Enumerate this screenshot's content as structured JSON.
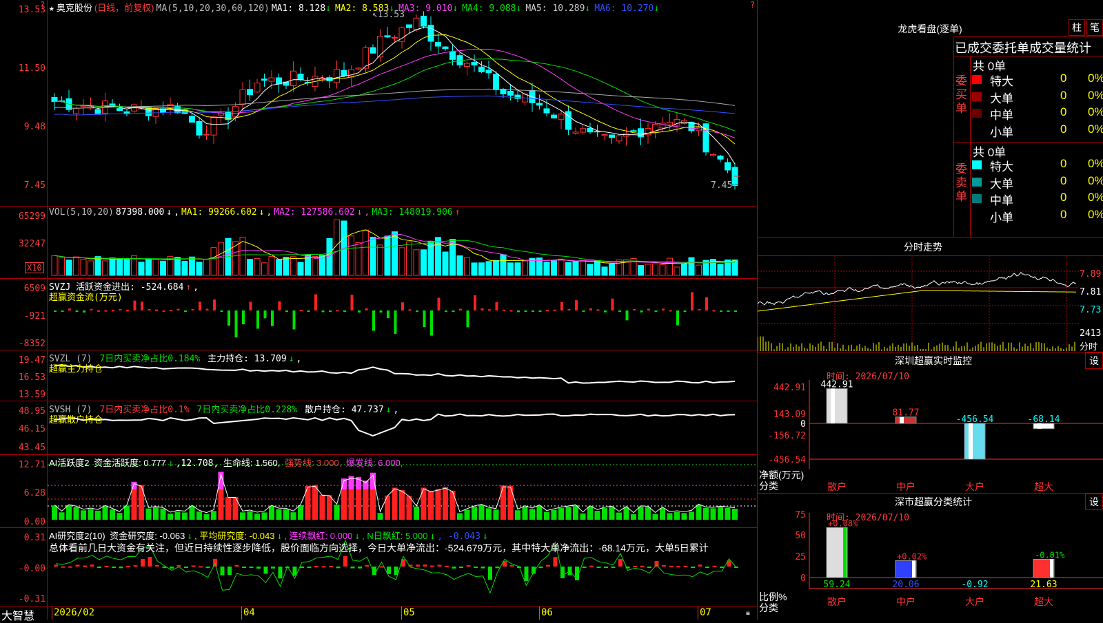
{
  "stock": {
    "name": "奥克股份",
    "mode": "(日线，前复权)"
  },
  "main": {
    "indicator": "MA(5,10,20,30,60,120)",
    "ma": [
      {
        "label": "MA1:",
        "value": "8.128",
        "dir": "↓",
        "color": "#ffffff"
      },
      {
        "label": "MA2:",
        "value": "8.583",
        "dir": "↓",
        "color": "#ffff00"
      },
      {
        "label": "MA3:",
        "value": "9.010",
        "dir": "↓",
        "color": "#ff3bff"
      },
      {
        "label": "MA4:",
        "value": "9.088",
        "dir": "↓",
        "color": "#00e000"
      },
      {
        "label": "MA5:",
        "value": "10.289",
        "dir": "↓",
        "color": "#cccccc"
      },
      {
        "label": "MA6:",
        "value": "10.270",
        "dir": "↓",
        "color": "#3050ff"
      }
    ],
    "y_labels": [
      "13.53",
      "11.50",
      "9.48",
      "7.45"
    ],
    "high_mark": "13.53",
    "low_mark": "7.45"
  },
  "vol": {
    "indicator": "VOL(5,10,20)",
    "value": "87398.000",
    "value_dir": "↓",
    "ma1": "MA1: 99266.602",
    "ma1_dir": "↓",
    "ma2": "MA2: 127586.602",
    "ma2_dir": "↓",
    "ma3": "MA3: 148019.906",
    "ma3_dir": "↑",
    "y_labels": [
      "65299",
      "32247"
    ],
    "unit": "X10"
  },
  "svzj": {
    "line1": "SVZJ  活跃资金进出: -524.684",
    "line1_dir": "↑",
    "line1_tail": ",",
    "line2": "超赢资金流(万元)",
    "y_labels": [
      "6509",
      "-921",
      "-8352"
    ]
  },
  "svzl": {
    "prefix": "SVZL (7) ",
    "green": "7日内买卖净占比0.184%",
    "white": " 主力持仓: 13.709",
    "dir": "↓",
    "tail": ",",
    "line2": "超赢主力持仓",
    "y_labels": [
      "19.47",
      "16.53",
      "13.59"
    ]
  },
  "svsh": {
    "prefix": "SVSH (7) ",
    "red": "7日内买卖净占比0.1%",
    "green": " 7日内买卖净占比0.228%",
    "white": " 散户持仓: 47.737",
    "dir": "↓",
    "tail": ",",
    "line2": "超赢散户持仓",
    "y_labels": [
      "48.95",
      "46.15",
      "43.45"
    ]
  },
  "ai1": {
    "title": "AI活跃度2",
    "t1": " 资金活跃度: 0.777",
    "t2": ",12.708,",
    "t3": " 生命线: 1.560,",
    "t4": " 强势线: 3.000,",
    "t5": " 爆发线: 6.000,",
    "y_labels": [
      "12.71",
      "6.28",
      "0.00"
    ]
  },
  "ai2": {
    "title": "AI研究度2(10)",
    "t1": " 资金研究度: -0.063",
    "t2": ", 平均研究度: -0.043",
    "t3": ", 连续飘红: 0.000",
    "t4": ", N日飘红: 5.000",
    "t5": ", -0.043",
    "summary": "总体看前几日大资金有关注，但近日持续性逐步降低，股价面临方向选择，今日大单净流出：-524.679万元，其中特大单净流出：-68.14万元，大单5日累计",
    "y_labels": [
      "0.31",
      "-0.00",
      "-0.31"
    ]
  },
  "dates": {
    "d1": "2026/02",
    "d2": "04",
    "d3": "05",
    "d4": "06",
    "d5": "07"
  },
  "bottom_tab": "大智慧",
  "right": {
    "lhkp": {
      "title": "龙虎看盘(逐单)",
      "btn1": "柱",
      "btn2": "笔",
      "subtitle": "已成交委托单成交量统计"
    },
    "buy": {
      "label": "委买单",
      "total": "共 0单",
      "rows": [
        {
          "name": "特大",
          "n": "0",
          "p": "0%",
          "color": "#ff0000"
        },
        {
          "name": "大单",
          "n": "0",
          "p": "0%",
          "color": "#9a0000"
        },
        {
          "name": "中单",
          "n": "0",
          "p": "0%",
          "color": "#6a0000"
        },
        {
          "name": "小单",
          "n": "0",
          "p": "0%",
          "color": "#000000"
        }
      ]
    },
    "sell": {
      "label": "委卖单",
      "total": "共 0单",
      "rows": [
        {
          "name": "特大",
          "n": "0",
          "p": "0%",
          "color": "#00ffff"
        },
        {
          "name": "大单",
          "n": "0",
          "p": "0%",
          "color": "#009a9a"
        },
        {
          "name": "中单",
          "n": "0",
          "p": "0%",
          "color": "#007a7a"
        },
        {
          "name": "小单",
          "n": "0",
          "p": "0%",
          "color": "#000000"
        }
      ]
    },
    "intraday": {
      "title": "分时走势",
      "y_labels": [
        "7.89",
        "7.81",
        "7.73"
      ],
      "vol_label": "2413",
      "vol_unit": "分时"
    },
    "rt": {
      "title": "深圳超赢实时监控",
      "btn": "设",
      "time": "时间: 2026/07/10",
      "y_labels": [
        "442.91",
        "143.09",
        "0",
        "-156.72",
        "-456.54"
      ],
      "side": "净额(万元)",
      "side2": "分类",
      "cats": [
        "散户",
        "中户",
        "大户",
        "超大"
      ],
      "values": [
        "442.91",
        "81.77",
        "-456.54",
        "-68.14"
      ]
    },
    "cls": {
      "title": "深市超赢分类统计",
      "btn": "设",
      "time": "时间: 2026/07/10",
      "y_labels": [
        "75",
        "50",
        "25",
        "0"
      ],
      "side": "比例%",
      "side2": "分类",
      "cats": [
        "散户",
        "中户",
        "大户",
        "超大"
      ],
      "tops": [
        "+0.08%",
        "+0.02%",
        "-0.01%"
      ],
      "bottoms": [
        "59.24",
        "20.06",
        "-0.92",
        "21.63"
      ]
    }
  }
}
